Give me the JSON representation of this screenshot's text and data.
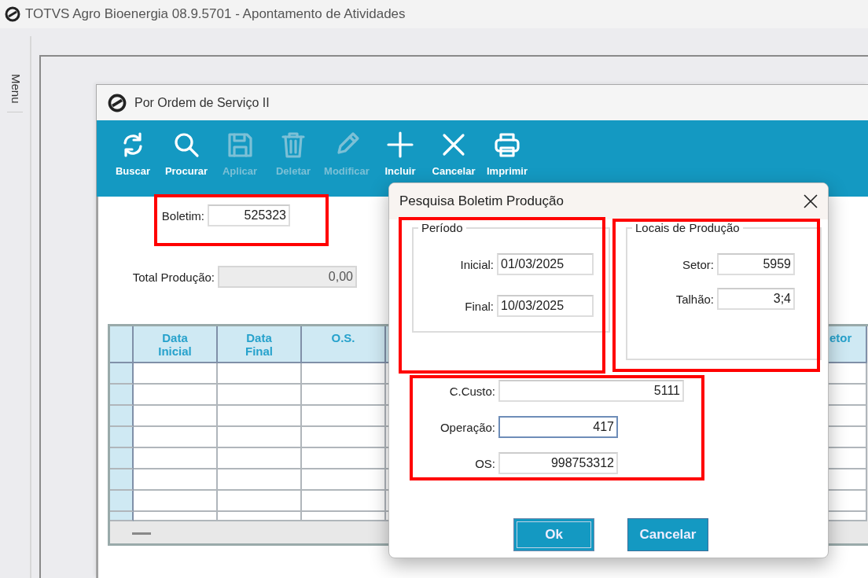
{
  "app": {
    "title": "TOTVS Agro Bioenergia 08.9.5701 - Apontamento de Atividades"
  },
  "side_tab": {
    "label": "Menu"
  },
  "window": {
    "title": "Por Ordem de Serviço II",
    "toolbar": [
      {
        "label": "Buscar",
        "kind": "refresh",
        "disabled": false
      },
      {
        "label": "Procurar",
        "kind": "search",
        "disabled": false
      },
      {
        "label": "Aplicar",
        "kind": "save",
        "disabled": true
      },
      {
        "label": "Deletar",
        "kind": "trash",
        "disabled": true
      },
      {
        "label": "Modificar",
        "kind": "pencil",
        "disabled": true
      },
      {
        "label": "Incluir",
        "kind": "plus",
        "disabled": false
      },
      {
        "label": "Cancelar",
        "kind": "cross",
        "disabled": false
      },
      {
        "label": "Imprimir",
        "kind": "printer",
        "disabled": false
      }
    ],
    "boletim": {
      "label": "Boletim:",
      "value": "525323"
    },
    "total": {
      "label": "Total Produção:",
      "value": "0,00",
      "disabled": true
    },
    "grid": {
      "columns": [
        "Data Inicial",
        "Data Final",
        "O.S.",
        "etor"
      ]
    }
  },
  "dialog": {
    "title": "Pesquisa Boletim Produção",
    "groups": [
      {
        "title": "Período",
        "fields": [
          {
            "label": "Inicial:",
            "value": "01/03/2025",
            "kind": "date"
          },
          {
            "label": "Final:",
            "value": "10/03/2025",
            "kind": "date"
          }
        ]
      },
      {
        "title": "Locais de Produção",
        "fields": [
          {
            "label": "Setor:",
            "value": "5959",
            "kind": "number"
          },
          {
            "label": "Talhão:",
            "value": "3;4",
            "kind": "number"
          }
        ]
      }
    ],
    "fields": [
      {
        "label": "C.Custo:",
        "value": "5111",
        "focused": false
      },
      {
        "label": "Operação:",
        "value": "417",
        "focused": true
      },
      {
        "label": "OS:",
        "value": "998753312",
        "focused": false
      }
    ],
    "buttons": [
      {
        "label": "Ok",
        "default": true
      },
      {
        "label": "Cancelar",
        "default": false
      }
    ]
  }
}
